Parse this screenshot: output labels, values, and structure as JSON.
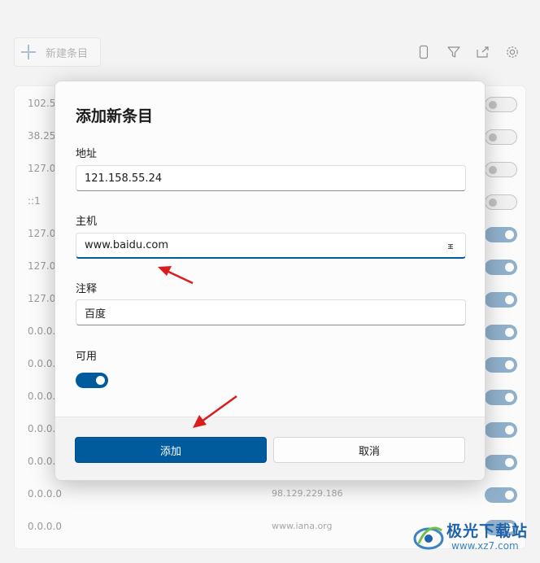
{
  "toolbar": {
    "new_entry_label": "新建条目",
    "icons": [
      "phone-icon",
      "filter-icon",
      "open-file-icon",
      "gear-icon"
    ]
  },
  "list": {
    "rows": [
      {
        "address": "102.54",
        "host": "",
        "enabled": false
      },
      {
        "address": "38.25.",
        "host": "",
        "enabled": false
      },
      {
        "address": "127.0.",
        "host": "",
        "enabled": false
      },
      {
        "address": "::1",
        "host": "",
        "enabled": false
      },
      {
        "address": "127.0.",
        "host": "",
        "enabled": true
      },
      {
        "address": "127.0.",
        "host": "",
        "enabled": true
      },
      {
        "address": "127.0.",
        "host": "",
        "enabled": true
      },
      {
        "address": "0.0.0.0",
        "host": "",
        "enabled": true
      },
      {
        "address": "0.0.0.0",
        "host": "",
        "enabled": true
      },
      {
        "address": "0.0.0.0",
        "host": "",
        "enabled": true
      },
      {
        "address": "0.0.0.0",
        "host": "",
        "enabled": true
      },
      {
        "address": "0.0.0.0",
        "host": "",
        "enabled": true
      },
      {
        "address": "0.0.0.0",
        "host": "98.129.229.186",
        "enabled": true
      },
      {
        "address": "0.0.0.0",
        "host": "www.iana.org",
        "enabled": true
      }
    ]
  },
  "dialog": {
    "title": "添加新条目",
    "address_label": "地址",
    "address_value": "121.158.55.24",
    "host_label": "主机",
    "host_value": "www.baidu.com",
    "comment_label": "注释",
    "comment_value": "百度",
    "enabled_label": "可用",
    "enabled": true,
    "add_button": "添加",
    "cancel_button": "取消"
  },
  "watermark": {
    "line1": "极光下载站",
    "line2": "www.xz7.com"
  },
  "colors": {
    "accent": "#005a9e",
    "toggle_on_dim": "#90b0cc",
    "annotation_arrow": "#d91c1c"
  }
}
